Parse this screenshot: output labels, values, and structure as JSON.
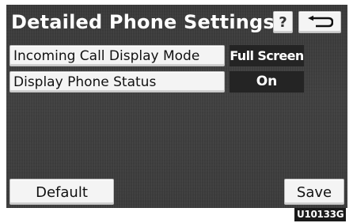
{
  "header": {
    "title": "Detailed Phone Settings",
    "help_label": "?"
  },
  "settings": [
    {
      "label": "Incoming Call Display Mode",
      "value": "Full Screen"
    },
    {
      "label": "Display Phone Status",
      "value": "On"
    }
  ],
  "footer": {
    "default_label": "Default",
    "save_label": "Save"
  },
  "image_code": "U10133G",
  "icons": {
    "back": "back-arrow-icon"
  }
}
